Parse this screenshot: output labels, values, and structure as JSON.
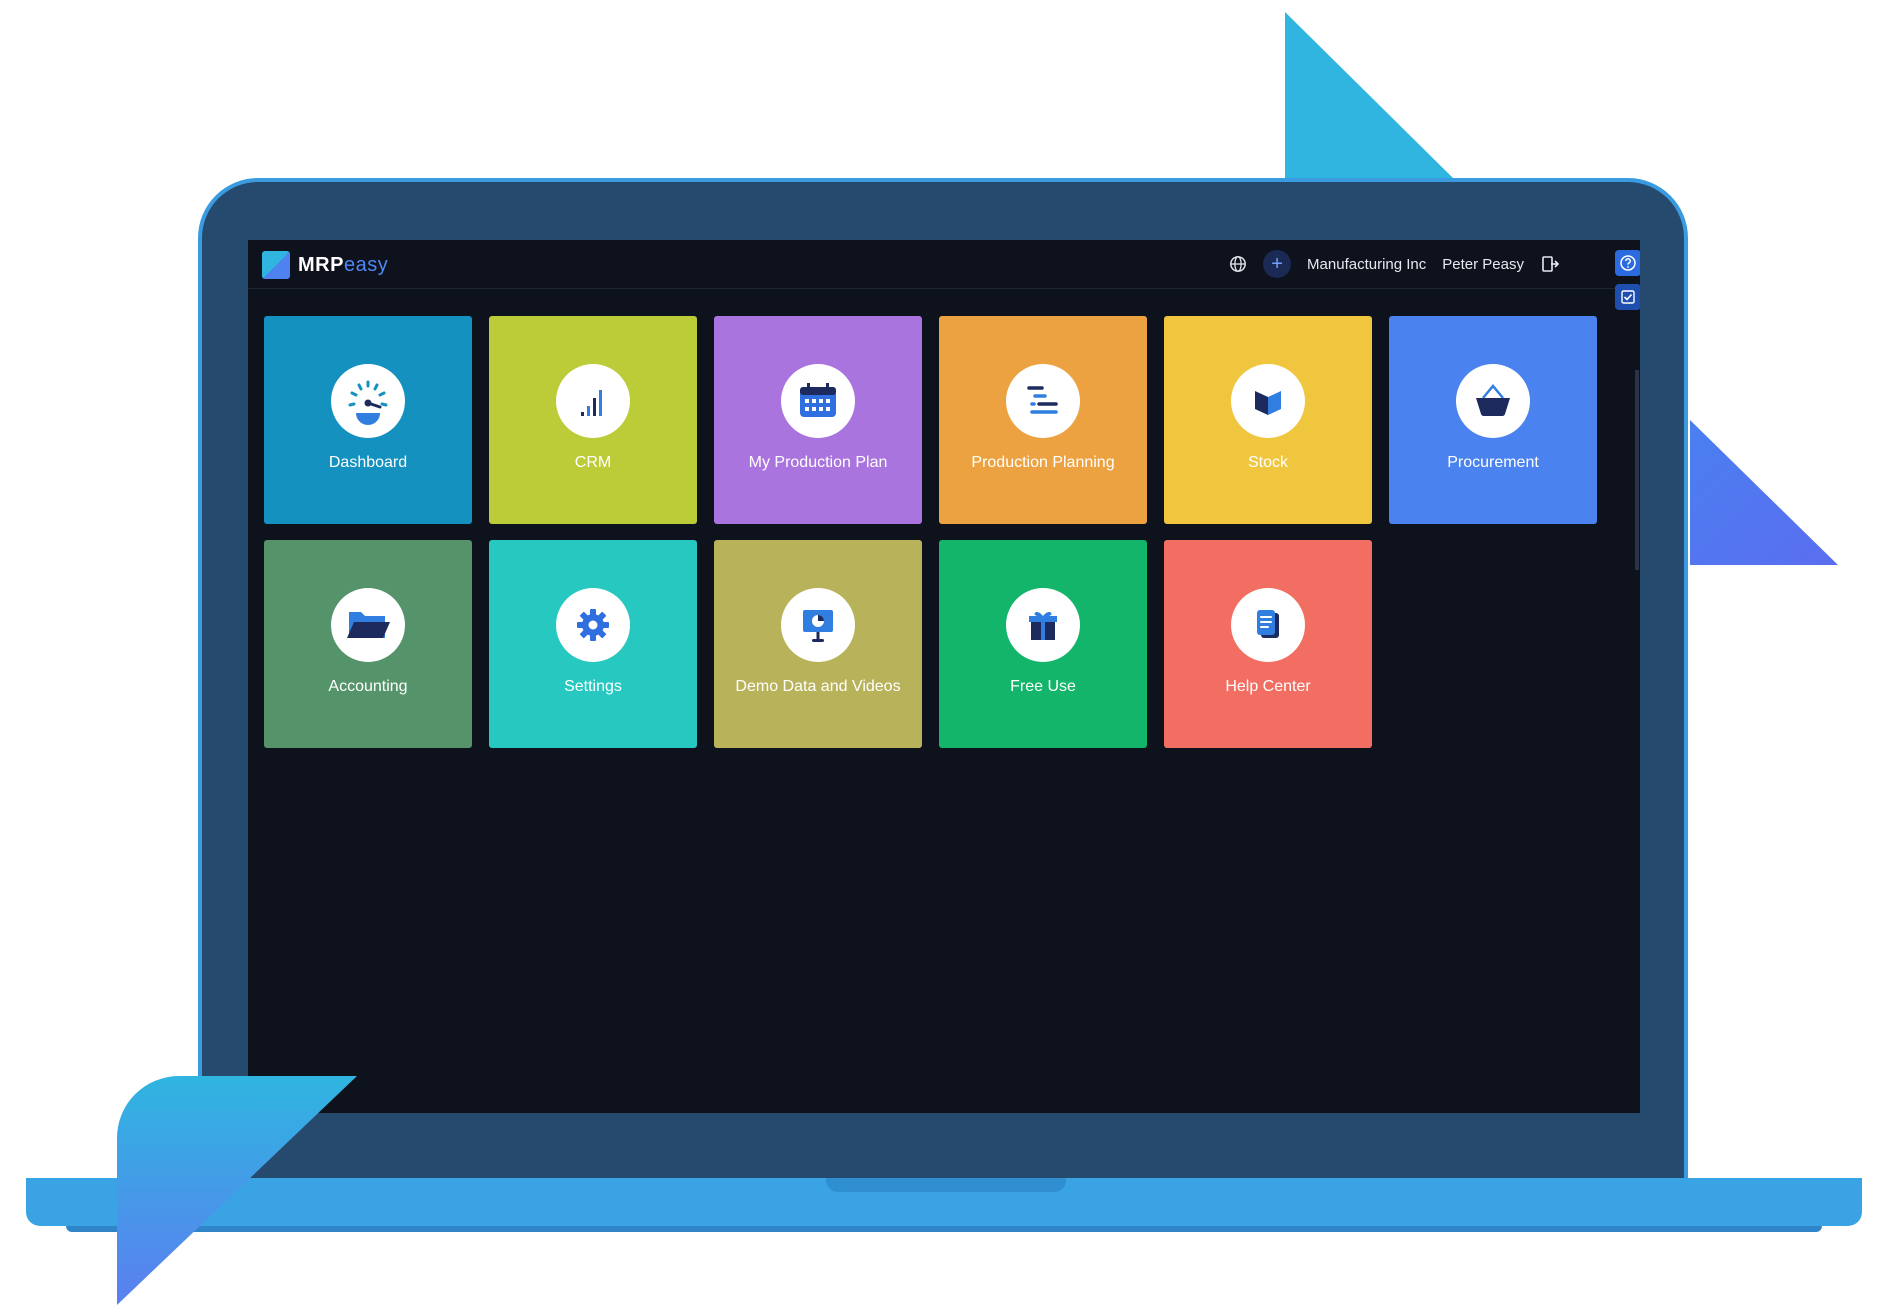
{
  "colors": {
    "brand_accent": "#4d88f5",
    "laptop_body": "#264a6e",
    "laptop_frame": "#3aa3e3",
    "screen_bg": "#0e121d",
    "deco_cyan": "#2fb5e0",
    "deco_blue": "#5b7ff0"
  },
  "app": {
    "logo_bold": "MRP",
    "logo_light": "easy"
  },
  "header": {
    "globe_icon": "globe-icon",
    "add_icon": "plus-icon",
    "add_label": "+",
    "company": "Manufacturing Inc",
    "user": "Peter Peasy",
    "logout_icon": "logout-icon",
    "help_icon": "question-icon",
    "tasks_icon": "checkbox-icon"
  },
  "tiles": [
    {
      "label": "Dashboard",
      "color": "#1491bf",
      "icon": "speedometer-icon"
    },
    {
      "label": "CRM",
      "color": "#bccc38",
      "icon": "signal-bars-icon"
    },
    {
      "label": "My Production Plan",
      "color": "#a974de",
      "icon": "calendar-icon"
    },
    {
      "label": "Production Planning",
      "color": "#eca240",
      "icon": "gantt-icon"
    },
    {
      "label": "Stock",
      "color": "#f1c63f",
      "icon": "box-icon"
    },
    {
      "label": "Procurement",
      "color": "#4a82f0",
      "icon": "basket-icon"
    },
    {
      "label": "Accounting",
      "color": "#55936a",
      "icon": "folder-icon"
    },
    {
      "label": "Settings",
      "color": "#26c8c0",
      "icon": "gear-icon"
    },
    {
      "label": "Demo Data and Videos",
      "color": "#b8b35a",
      "icon": "presentation-icon"
    },
    {
      "label": "Free Use",
      "color": "#13b56a",
      "icon": "gift-icon"
    },
    {
      "label": "Help Center",
      "color": "#f26e62",
      "icon": "document-icon"
    }
  ]
}
